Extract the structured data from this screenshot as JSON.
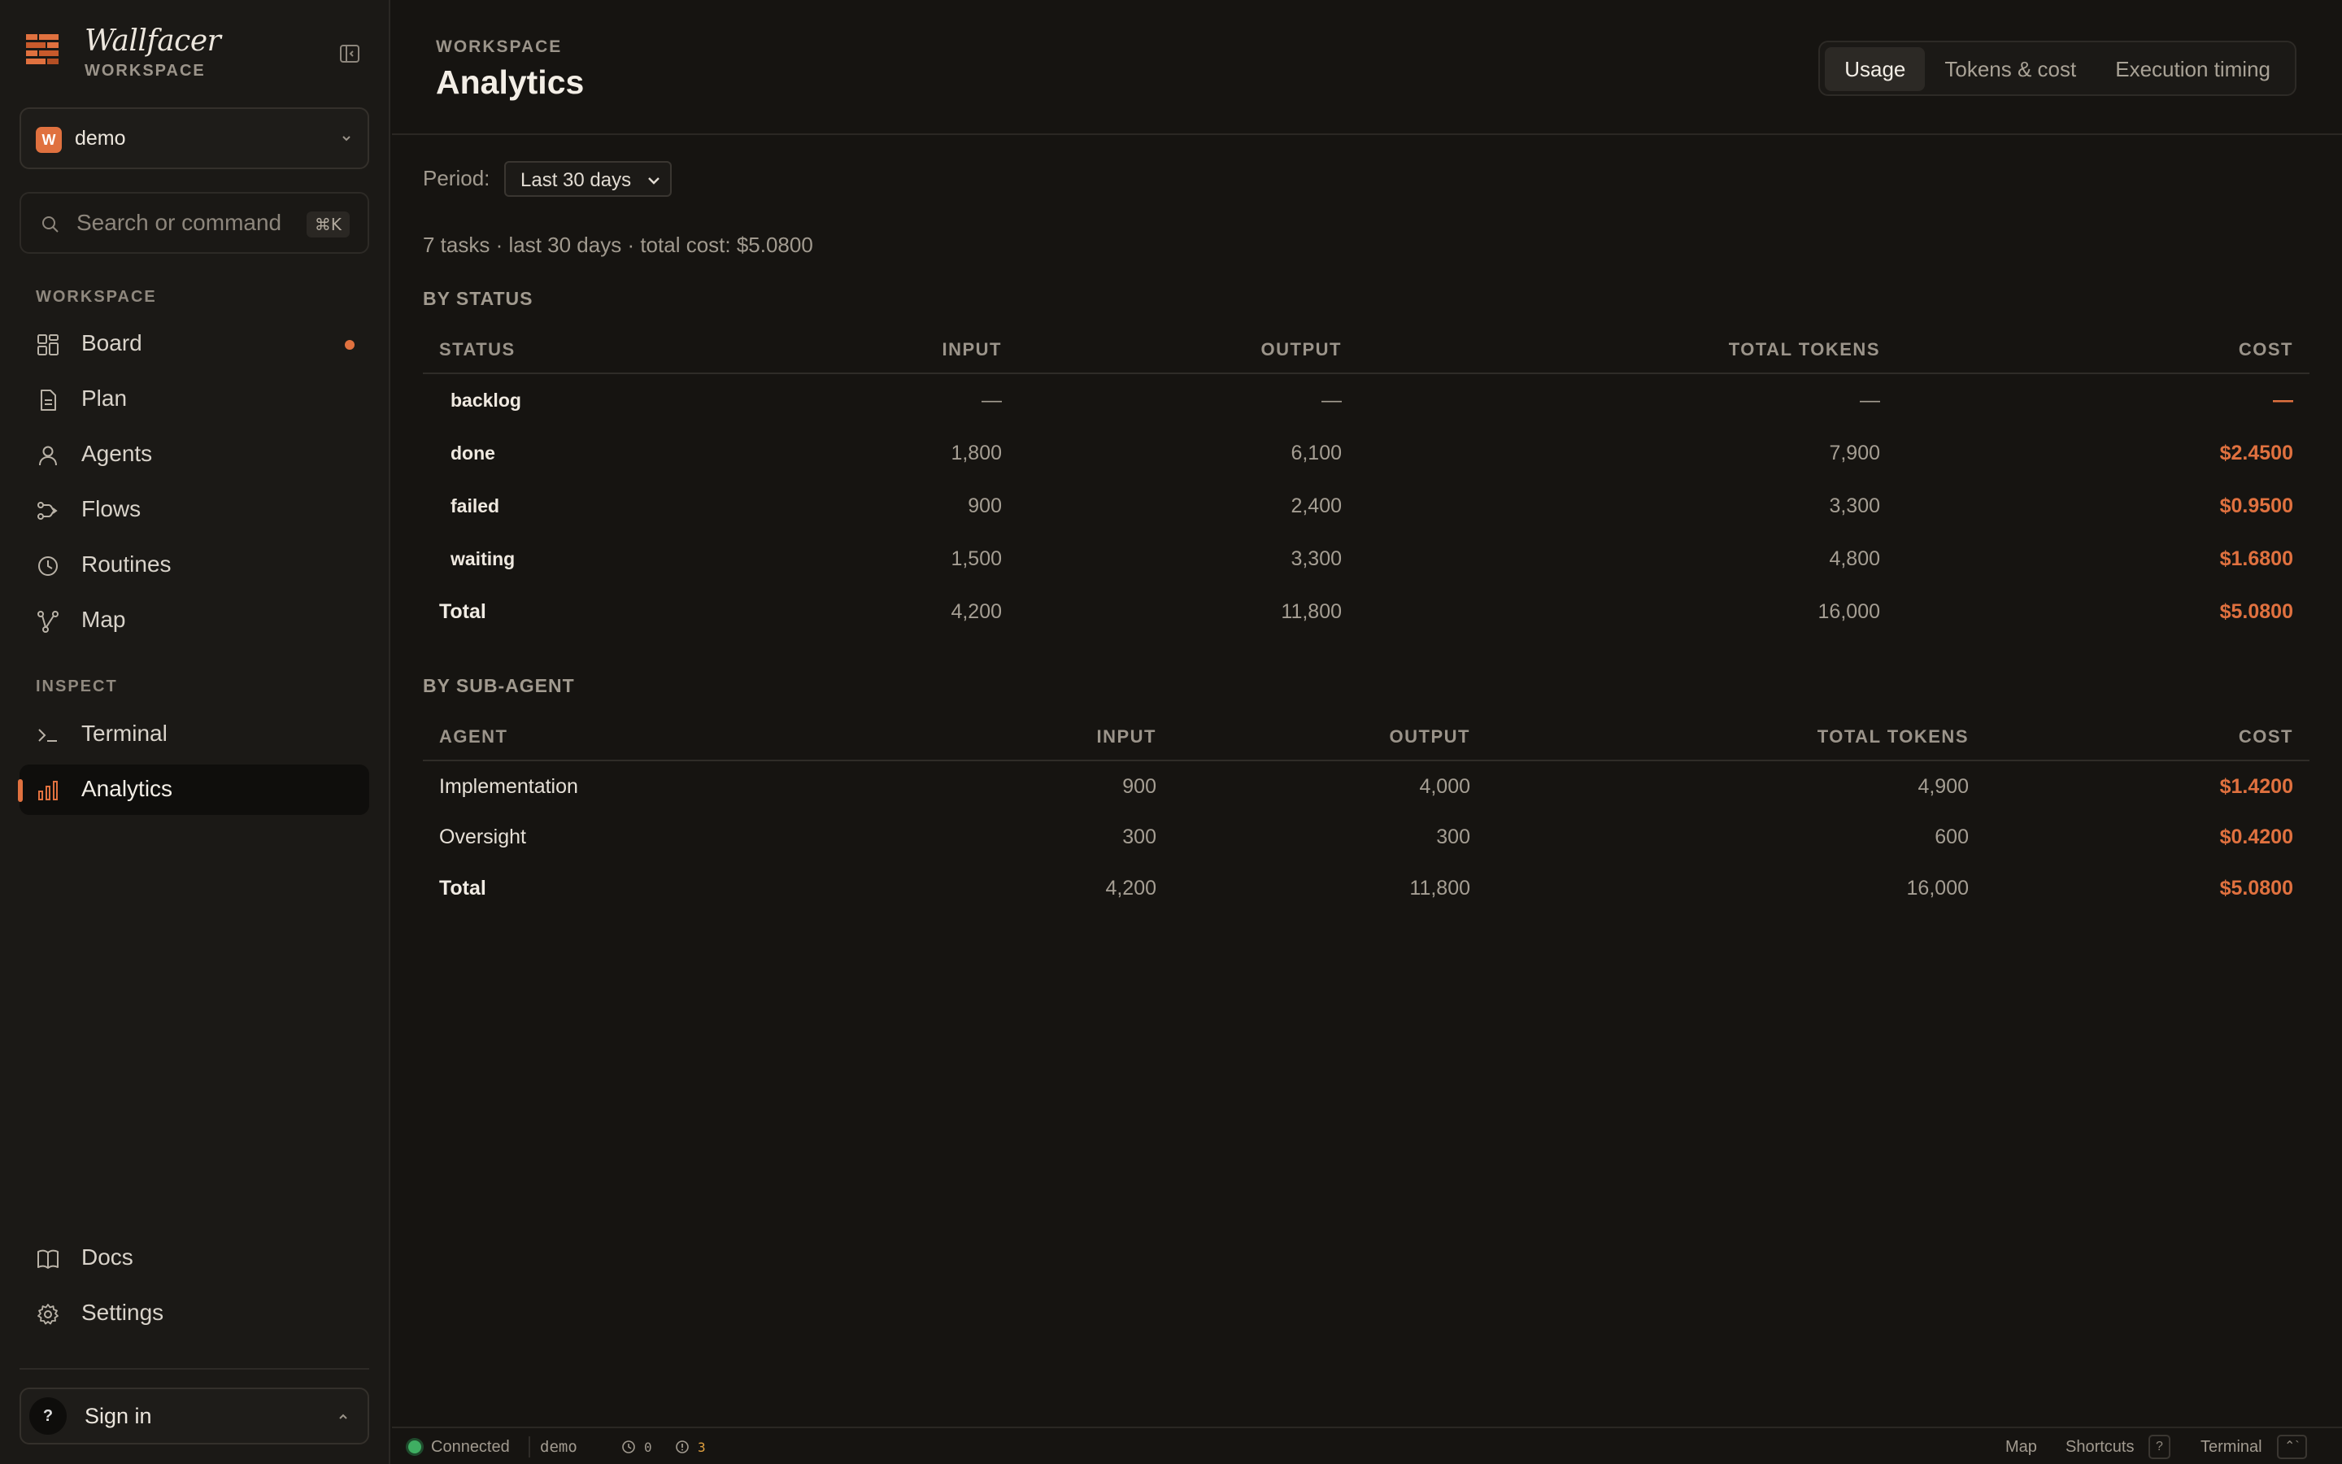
{
  "brand": {
    "name": "Wallfacer",
    "subtitle": "WORKSPACE"
  },
  "workspace_selector": {
    "badge": "W",
    "name": "demo"
  },
  "search": {
    "placeholder": "Search or command",
    "shortcut": "⌘K"
  },
  "sidebar": {
    "workspace_section": "WORKSPACE",
    "workspace_items": [
      {
        "label": "Board",
        "icon": "board-icon",
        "has_dot": true
      },
      {
        "label": "Plan",
        "icon": "document-icon"
      },
      {
        "label": "Agents",
        "icon": "user-icon"
      },
      {
        "label": "Flows",
        "icon": "flow-icon"
      },
      {
        "label": "Routines",
        "icon": "clock-icon"
      },
      {
        "label": "Map",
        "icon": "map-branch-icon"
      }
    ],
    "inspect_section": "INSPECT",
    "inspect_items": [
      {
        "label": "Terminal",
        "icon": "terminal-icon"
      },
      {
        "label": "Analytics",
        "icon": "bar-chart-icon",
        "active": true
      }
    ],
    "footer_items": [
      {
        "label": "Docs",
        "icon": "book-icon"
      },
      {
        "label": "Settings",
        "icon": "gear-icon"
      }
    ],
    "signin": {
      "avatar": "?",
      "label": "Sign in"
    }
  },
  "header": {
    "breadcrumb": "WORKSPACE",
    "title": "Analytics",
    "tabs": [
      {
        "label": "Usage",
        "active": true
      },
      {
        "label": "Tokens & cost"
      },
      {
        "label": "Execution timing"
      }
    ]
  },
  "filters": {
    "period_label": "Period:",
    "period_value": "Last 30 days"
  },
  "summary": "7 tasks · last 30 days · total cost: $5.0800",
  "by_status": {
    "title": "BY STATUS",
    "columns": [
      "STATUS",
      "INPUT",
      "OUTPUT",
      "TOTAL TOKENS",
      "COST"
    ],
    "rows": [
      {
        "status": "backlog",
        "input": "—",
        "output": "—",
        "total": "—",
        "cost": "—"
      },
      {
        "status": "done",
        "input": "1,800",
        "output": "6,100",
        "total": "7,900",
        "cost": "$2.4500"
      },
      {
        "status": "failed",
        "input": "900",
        "output": "2,400",
        "total": "3,300",
        "cost": "$0.9500"
      },
      {
        "status": "waiting",
        "input": "1,500",
        "output": "3,300",
        "total": "4,800",
        "cost": "$1.6800"
      }
    ],
    "total": {
      "label": "Total",
      "input": "4,200",
      "output": "11,800",
      "total": "16,000",
      "cost": "$5.0800"
    }
  },
  "by_agent": {
    "title": "BY SUB-AGENT",
    "columns": [
      "AGENT",
      "INPUT",
      "OUTPUT",
      "TOTAL TOKENS",
      "COST"
    ],
    "rows": [
      {
        "agent": "Implementation",
        "input": "900",
        "output": "4,000",
        "total": "4,900",
        "cost": "$1.4200"
      },
      {
        "agent": "Oversight",
        "input": "300",
        "output": "300",
        "total": "600",
        "cost": "$0.4200"
      }
    ],
    "total": {
      "label": "Total",
      "input": "4,200",
      "output": "11,800",
      "total": "16,000",
      "cost": "$5.0800"
    }
  },
  "statusbar": {
    "connection": "Connected",
    "workspace": "demo",
    "clock_count": "0",
    "alert_count": "3",
    "map_label": "Map",
    "shortcuts_label": "Shortcuts",
    "shortcuts_key": "?",
    "terminal_label": "Terminal",
    "terminal_key": "⌃`"
  },
  "colors": {
    "accent": "#e0713f",
    "background": "#161411",
    "sidebar": "#1b1916",
    "connected": "#3fae62"
  }
}
